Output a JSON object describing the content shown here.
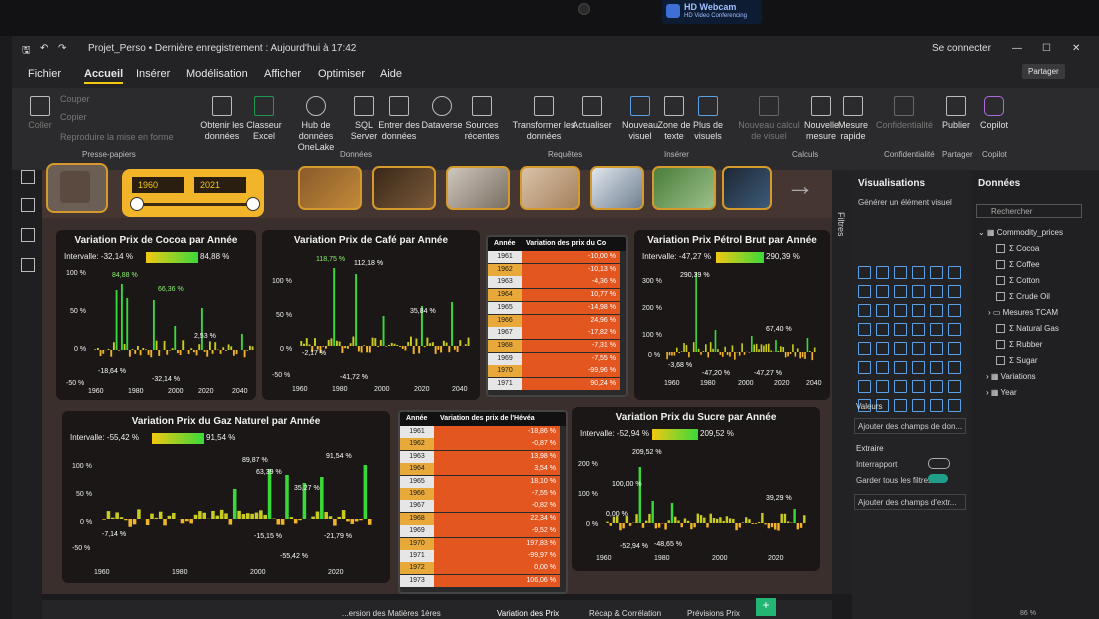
{
  "webcam": {
    "title": "HD Webcam",
    "subtitle": "HD Video Conferencing"
  },
  "titlebar": {
    "doc": "Projet_Perso • Dernière enregistrement : Aujourd'hui à 17:42",
    "signin": "Se connecter"
  },
  "menu": [
    "Fichier",
    "Accueil",
    "Insérer",
    "Modélisation",
    "Afficher",
    "Optimiser",
    "Aide"
  ],
  "share_label": "Partager",
  "ribbon": {
    "clipboard": {
      "paste": "Coller",
      "cut": "Couper",
      "copy": "Copier",
      "format": "Reproduire la mise en forme",
      "group": "Presse-papiers"
    },
    "data": {
      "get": "Obtenir les données",
      "excel": "Classeur Excel",
      "onelake": "Hub de données OneLake",
      "sql": "SQL Server",
      "enter": "Entrer des données",
      "dataverse": "Dataverse",
      "recent": "Sources récentes",
      "group": "Données"
    },
    "queries": {
      "transform": "Transformer les données",
      "refresh": "Actualiser",
      "group": "Requêtes"
    },
    "insert": {
      "visual": "Nouveau visuel",
      "text": "Zone de texte",
      "more": "Plus de visuels",
      "group": "Insérer"
    },
    "calc": {
      "newcalc": "Nouveau calcul de visuel",
      "measure": "Nouvelle mesure",
      "quick": "Mesure rapide",
      "group": "Calculs"
    },
    "sens": {
      "label": "Confidentialité",
      "group": "Confidentialité"
    },
    "publish": {
      "label": "Publier",
      "group": "Partager"
    },
    "copilot": {
      "label": "Copilot",
      "group": "Copilot"
    }
  },
  "slicer": {
    "from": "1960",
    "to": "2021"
  },
  "charts": {
    "cocoa": {
      "title": "Variation Prix de Cocoa par Année",
      "interval_label": "Intervalle:",
      "min": "-32,14 %",
      "max": "84,88 %",
      "y_ticks": [
        "100 %",
        "50 %",
        "0 %",
        "-50 %"
      ],
      "x_ticks": [
        "1960",
        "1980",
        "2000",
        "2020",
        "2040"
      ],
      "labels": [
        "84,88 %",
        "66,36 %",
        "2,53 %",
        "-18,64 %",
        "-32,14 %"
      ]
    },
    "cafe": {
      "title": "Variation Prix de Café par Année",
      "y_ticks": [
        "100 %",
        "50 %",
        "0 %",
        "-50 %"
      ],
      "x_ticks": [
        "1960",
        "1980",
        "2000",
        "2020",
        "2040"
      ],
      "labels": [
        "118,75 %",
        "112,18 %",
        "35,84 %",
        "-2,17 %",
        "-41,72 %"
      ]
    },
    "petrol": {
      "title": "Variation Prix Pétrol Brut par Année",
      "interval_label": "Intervalle:",
      "min": "-47,27 %",
      "max": "290,39 %",
      "y_ticks": [
        "300 %",
        "200 %",
        "100 %",
        "0 %"
      ],
      "x_ticks": [
        "1960",
        "1980",
        "2000",
        "2020",
        "2040"
      ],
      "labels": [
        "290,39 %",
        "67,40 %",
        "-3,68 %",
        "-47,20 %",
        "-47,27 %"
      ]
    },
    "gaz": {
      "title": "Variation Prix du Gaz Naturel par Année",
      "interval_label": "Intervalle:",
      "min": "-55,42 %",
      "max": "91,54 %",
      "y_ticks": [
        "100 %",
        "50 %",
        "0 %",
        "-50 %"
      ],
      "x_ticks": [
        "1960",
        "1980",
        "2000",
        "2020"
      ],
      "labels": [
        "89,87 %",
        "63,39 %",
        "35,27 %",
        "91,54 %",
        "-7,14 %",
        "-15,15 %",
        "-55,42 %",
        "-21,79 %"
      ]
    },
    "sucre": {
      "title": "Variation Prix du Sucre par Année",
      "interval_label": "Intervalle:",
      "min": "-52,94 %",
      "max": "209,52 %",
      "y_ticks": [
        "200 %",
        "100 %",
        "0 %"
      ],
      "x_ticks": [
        "1960",
        "1980",
        "2000",
        "2020"
      ],
      "labels": [
        "209,52 %",
        "100,00 %",
        "0,00 %",
        "39,29 %",
        "-52,94 %",
        "-48,65 %"
      ]
    }
  },
  "table_cafe": {
    "col1": "Année",
    "col2": "Variation des prix du Co",
    "rows": [
      [
        "1961",
        "-10,00 %"
      ],
      [
        "1962",
        "-10,13 %"
      ],
      [
        "1963",
        "-4,36 %"
      ],
      [
        "1964",
        "10,77 %"
      ],
      [
        "1965",
        "-14,98 %"
      ],
      [
        "1966",
        "24,96 %"
      ],
      [
        "1967",
        "-17,82 %"
      ],
      [
        "1968",
        "-7,31 %"
      ],
      [
        "1969",
        "-7,55 %"
      ],
      [
        "1970",
        "-99,96 %"
      ],
      [
        "1971",
        "90,24 %"
      ]
    ]
  },
  "table_heveas": {
    "col1": "Année",
    "col2": "Variation des prix de l'Hévéa",
    "rows": [
      [
        "1961",
        "-18,86 %"
      ],
      [
        "1962",
        "-0,87 %"
      ],
      [
        "1963",
        "13,98 %"
      ],
      [
        "1964",
        "3,54 %"
      ],
      [
        "1965",
        "18,10 %"
      ],
      [
        "1966",
        "-7,55 %"
      ],
      [
        "1967",
        "-0,82 %"
      ],
      [
        "1968",
        "22,34 %"
      ],
      [
        "1969",
        "-9,52 %"
      ],
      [
        "1970",
        "197,83 %"
      ],
      [
        "1971",
        "-99,97 %"
      ],
      [
        "1972",
        "0,00 %"
      ],
      [
        "1973",
        "106,06 %"
      ]
    ]
  },
  "filters_label": "Filtres",
  "viz": {
    "title": "Visualisations",
    "build": "Générer un élément visuel",
    "values": "Valeurs",
    "add_fields": "Ajouter des champs de don...",
    "drill": "Extraire",
    "cross": "Interrapport",
    "keep": "Garder tous les filtres",
    "add_drill": "Ajouter des champs d'extr..."
  },
  "data_pane": {
    "title": "Données",
    "search": "Rechercher",
    "table": "Commodity_prices",
    "fields": [
      "Cocoa",
      "Coffee",
      "Cotton",
      "Crude Oil"
    ],
    "measures": "Mesures TCAM",
    "fields2": [
      "Natural Gas",
      "Rubber",
      "Sugar"
    ],
    "variations": "Variations",
    "year": "Year"
  },
  "tabs": [
    "...ersion des Matières 1ères",
    "Variation des Prix",
    "Récap & Corrélation",
    "Prévisions Prix"
  ],
  "zoom": "86 %"
}
